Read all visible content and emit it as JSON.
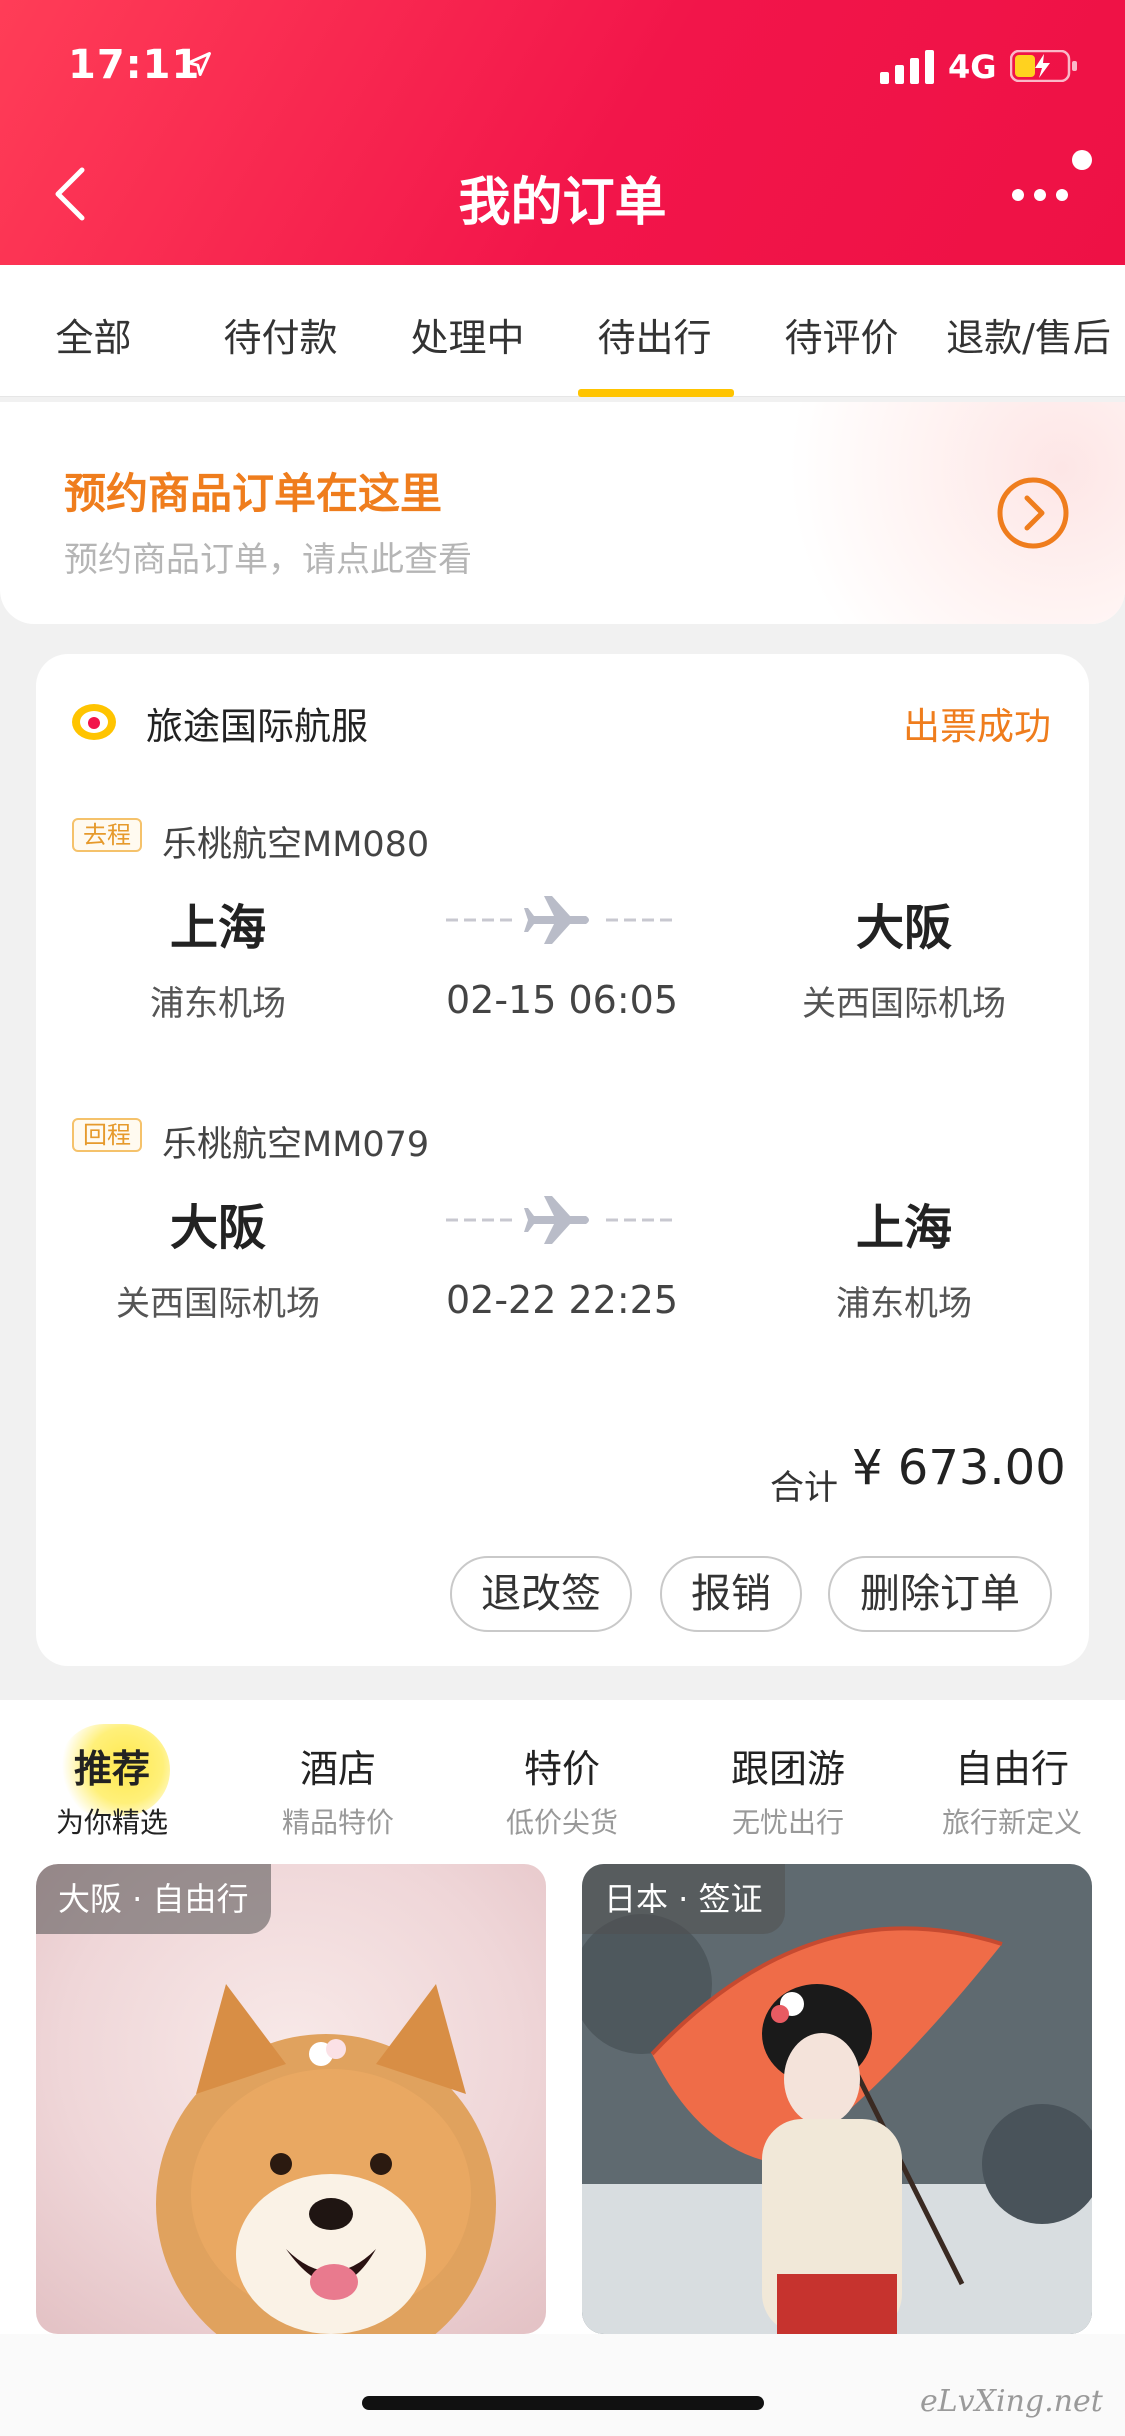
{
  "status_bar": {
    "time": "17:11",
    "network": "4G"
  },
  "header": {
    "title": "我的订单"
  },
  "tabs": [
    "全部",
    "待付款",
    "处理中",
    "待出行",
    "待评价",
    "退款/售后"
  ],
  "banner": {
    "title": "预约商品订单在这里",
    "subtitle": "预约商品订单，请点此查看"
  },
  "order": {
    "shop": "旅途国际航服",
    "status": "出票成功",
    "outbound": {
      "tag": "去程",
      "flight": "乐桃航空MM080",
      "from_city": "上海",
      "from_airport": "浦东机场",
      "to_city": "大阪",
      "to_airport": "关西国际机场",
      "datetime": "02-15 06:05"
    },
    "return": {
      "tag": "回程",
      "flight": "乐桃航空MM079",
      "from_city": "大阪",
      "from_airport": "关西国际机场",
      "to_city": "上海",
      "to_airport": "浦东机场",
      "datetime": "02-22 22:25"
    },
    "total_label": "合计",
    "total_value": "¥ 673.00",
    "buttons": {
      "change": "退改签",
      "reimburse": "报销",
      "delete": "删除订单"
    }
  },
  "recommend": [
    {
      "title": "推荐",
      "sub": "为你精选"
    },
    {
      "title": "酒店",
      "sub": "精品特价"
    },
    {
      "title": "特价",
      "sub": "低价尖货"
    },
    {
      "title": "跟团游",
      "sub": "无忧出行"
    },
    {
      "title": "自由行",
      "sub": "旅行新定义"
    }
  ],
  "products": [
    {
      "label": "大阪 · 自由行"
    },
    {
      "label": "日本 · 签证"
    }
  ],
  "watermark": "eLvXing.net",
  "colors": {
    "header": "#f2154a",
    "accent_orange": "#ef7d1d",
    "tab_underline": "#ffc400"
  }
}
